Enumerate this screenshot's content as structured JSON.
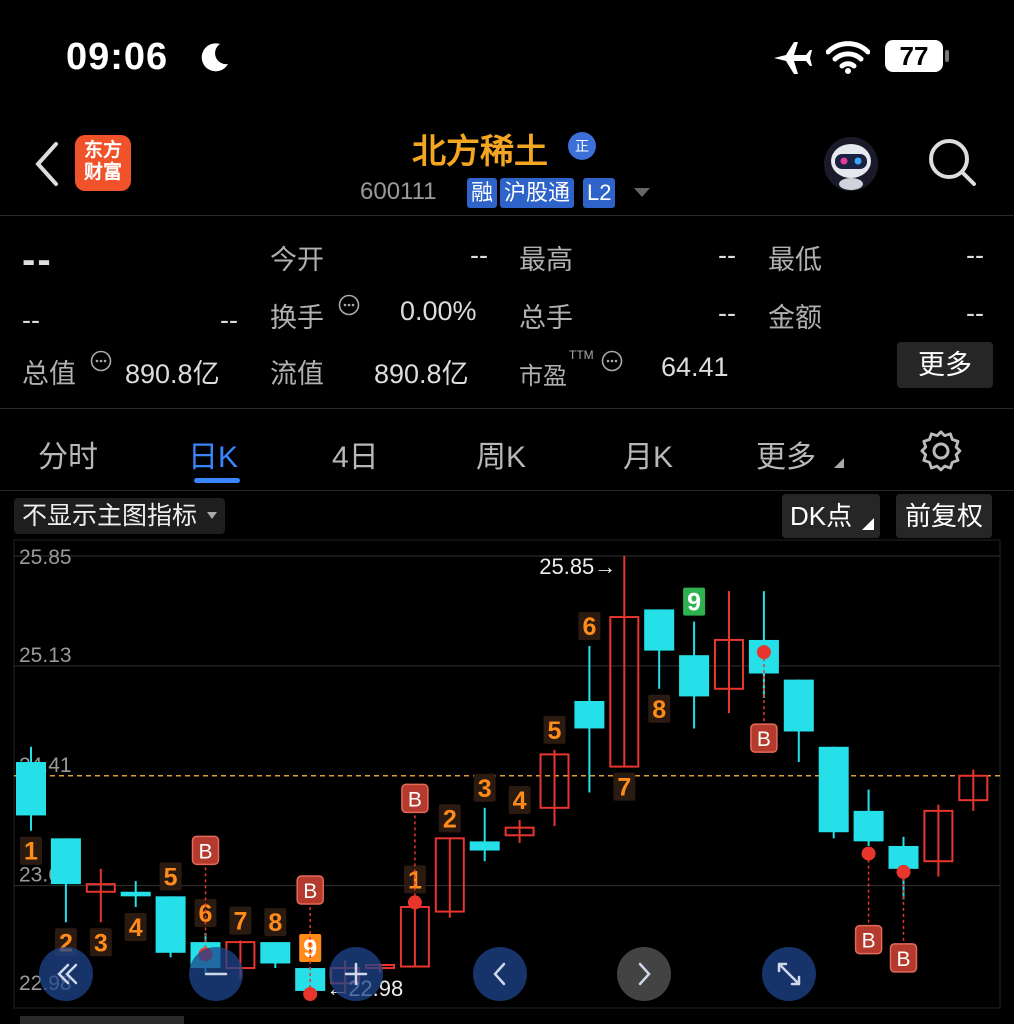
{
  "status_bar": {
    "time": "09:06",
    "battery": "77"
  },
  "header": {
    "logo_line1": "东方",
    "logo_line2": "财富",
    "stock_name": "北方稀土",
    "badge": "正",
    "stock_code": "600111",
    "tags": [
      "融",
      "沪股通",
      "L2"
    ]
  },
  "quote": {
    "price": "--",
    "change": "--",
    "change_pct": "--",
    "rows": [
      [
        {
          "label": "今开",
          "value": "--"
        },
        {
          "label": "最高",
          "value": "--"
        },
        {
          "label": "最低",
          "value": "--"
        }
      ],
      [
        {
          "label": "换手",
          "value": "0.00%"
        },
        {
          "label": "总手",
          "value": "--"
        },
        {
          "label": "金额",
          "value": "--"
        }
      ],
      [
        {
          "label": "总值",
          "value": "890.8亿"
        },
        {
          "label": "流值",
          "value": "890.8亿"
        },
        {
          "label": "市盈",
          "sup": "TTM",
          "value": "64.41"
        }
      ]
    ],
    "more_label": "更多"
  },
  "tabs": [
    "分时",
    "日K",
    "4日",
    "周K",
    "月K",
    "更多"
  ],
  "active_tab": "日K",
  "toolbar": {
    "indicator": "不显示主图指标",
    "dk": "DK点",
    "fuquan": "前复权"
  },
  "chart_data": {
    "type": "candlestick",
    "y_ticks": [
      "25.85",
      "25.13",
      "24.41",
      "23.69",
      "22.98"
    ],
    "ylim": [
      22.98,
      25.85
    ],
    "reference_price": 24.41,
    "max_label": "25.85",
    "min_label": "22.98",
    "colors": {
      "up": "#e8352e",
      "down": "#25e0e8",
      "ref": "#e0a030",
      "count": "#ff8c1a",
      "nine_green": "#2eb14f"
    },
    "candles": [
      {
        "o": 24.5,
        "h": 24.6,
        "l": 24.05,
        "c": 24.15
      },
      {
        "o": 24.0,
        "h": 24.0,
        "l": 23.45,
        "c": 23.7
      },
      {
        "o": 23.65,
        "h": 23.8,
        "l": 23.45,
        "c": 23.7
      },
      {
        "o": 23.65,
        "h": 23.72,
        "l": 23.55,
        "c": 23.62
      },
      {
        "o": 23.62,
        "h": 23.62,
        "l": 23.22,
        "c": 23.25
      },
      {
        "o": 23.32,
        "h": 23.38,
        "l": 23.12,
        "c": 23.15
      },
      {
        "o": 23.15,
        "h": 23.33,
        "l": 23.08,
        "c": 23.32
      },
      {
        "o": 23.32,
        "h": 23.32,
        "l": 23.15,
        "c": 23.18
      },
      {
        "o": 23.15,
        "h": 23.15,
        "l": 22.98,
        "c": 23.0
      },
      {
        "o": 23.05,
        "h": 23.2,
        "l": 22.98,
        "c": 23.15
      },
      {
        "o": 23.15,
        "h": 23.18,
        "l": 23.12,
        "c": 23.17
      },
      {
        "o": 23.16,
        "h": 23.6,
        "l": 23.16,
        "c": 23.55
      },
      {
        "o": 23.52,
        "h": 24.0,
        "l": 23.48,
        "c": 24.0
      },
      {
        "o": 23.98,
        "h": 24.2,
        "l": 23.85,
        "c": 23.92
      },
      {
        "o": 24.02,
        "h": 24.12,
        "l": 23.97,
        "c": 24.07
      },
      {
        "o": 24.2,
        "h": 24.58,
        "l": 24.08,
        "c": 24.55
      },
      {
        "o": 24.9,
        "h": 25.26,
        "l": 24.3,
        "c": 24.72
      },
      {
        "o": 24.47,
        "h": 25.85,
        "l": 24.47,
        "c": 25.45
      },
      {
        "o": 25.5,
        "h": 25.5,
        "l": 24.98,
        "c": 25.23
      },
      {
        "o": 25.2,
        "h": 25.42,
        "l": 24.72,
        "c": 24.93
      },
      {
        "o": 24.98,
        "h": 25.62,
        "l": 24.82,
        "c": 25.3
      },
      {
        "o": 25.3,
        "h": 25.62,
        "l": 24.92,
        "c": 25.08
      },
      {
        "o": 25.04,
        "h": 25.04,
        "l": 24.5,
        "c": 24.7
      },
      {
        "o": 24.6,
        "h": 24.6,
        "l": 24.0,
        "c": 24.04
      },
      {
        "o": 24.18,
        "h": 24.32,
        "l": 23.95,
        "c": 23.98
      },
      {
        "o": 23.95,
        "h": 24.01,
        "l": 23.6,
        "c": 23.8
      },
      {
        "o": 23.85,
        "h": 24.22,
        "l": 23.75,
        "c": 24.18
      },
      {
        "o": 24.25,
        "h": 24.45,
        "l": 24.18,
        "c": 24.41
      }
    ],
    "seq_labels": [
      {
        "i": 0,
        "t": "1",
        "pos": "below"
      },
      {
        "i": 1,
        "t": "2",
        "pos": "below"
      },
      {
        "i": 2,
        "t": "3",
        "pos": "below"
      },
      {
        "i": 3,
        "t": "4",
        "pos": "below"
      },
      {
        "i": 4,
        "t": "5",
        "pos": "above"
      },
      {
        "i": 5,
        "t": "6",
        "pos": "above"
      },
      {
        "i": 6,
        "t": "7",
        "pos": "above"
      },
      {
        "i": 7,
        "t": "8",
        "pos": "above"
      },
      {
        "i": 8,
        "t": "9",
        "pos": "above",
        "style": "white"
      },
      {
        "i": 11,
        "t": "1",
        "pos": "above"
      },
      {
        "i": 12,
        "t": "2",
        "pos": "above"
      },
      {
        "i": 13,
        "t": "3",
        "pos": "above"
      },
      {
        "i": 14,
        "t": "4",
        "pos": "above"
      },
      {
        "i": 15,
        "t": "5",
        "pos": "above"
      },
      {
        "i": 16,
        "t": "6",
        "pos": "above"
      },
      {
        "i": 17,
        "t": "7",
        "pos": "below"
      },
      {
        "i": 18,
        "t": "8",
        "pos": "below"
      },
      {
        "i": 19,
        "t": "9",
        "pos": "above",
        "style": "green"
      }
    ],
    "buy_marks": [
      {
        "i": 5,
        "dot": 23.24,
        "label": "B",
        "dir": "up"
      },
      {
        "i": 8,
        "dot": 22.98,
        "label": "B",
        "dir": "up"
      },
      {
        "i": 11,
        "dot": 23.58,
        "label": "B",
        "dir": "up"
      },
      {
        "i": 21,
        "dot": 25.22,
        "label": "B",
        "dir": "down"
      },
      {
        "i": 24,
        "dot": 23.9,
        "label": "B",
        "dir": "down"
      },
      {
        "i": 25,
        "dot": 23.78,
        "label": "B",
        "dir": "down"
      }
    ]
  },
  "chart_nav": [
    "double-left-icon",
    "minus-icon",
    "plus-icon",
    "left-icon",
    "right-icon",
    "fullscreen-icon"
  ]
}
